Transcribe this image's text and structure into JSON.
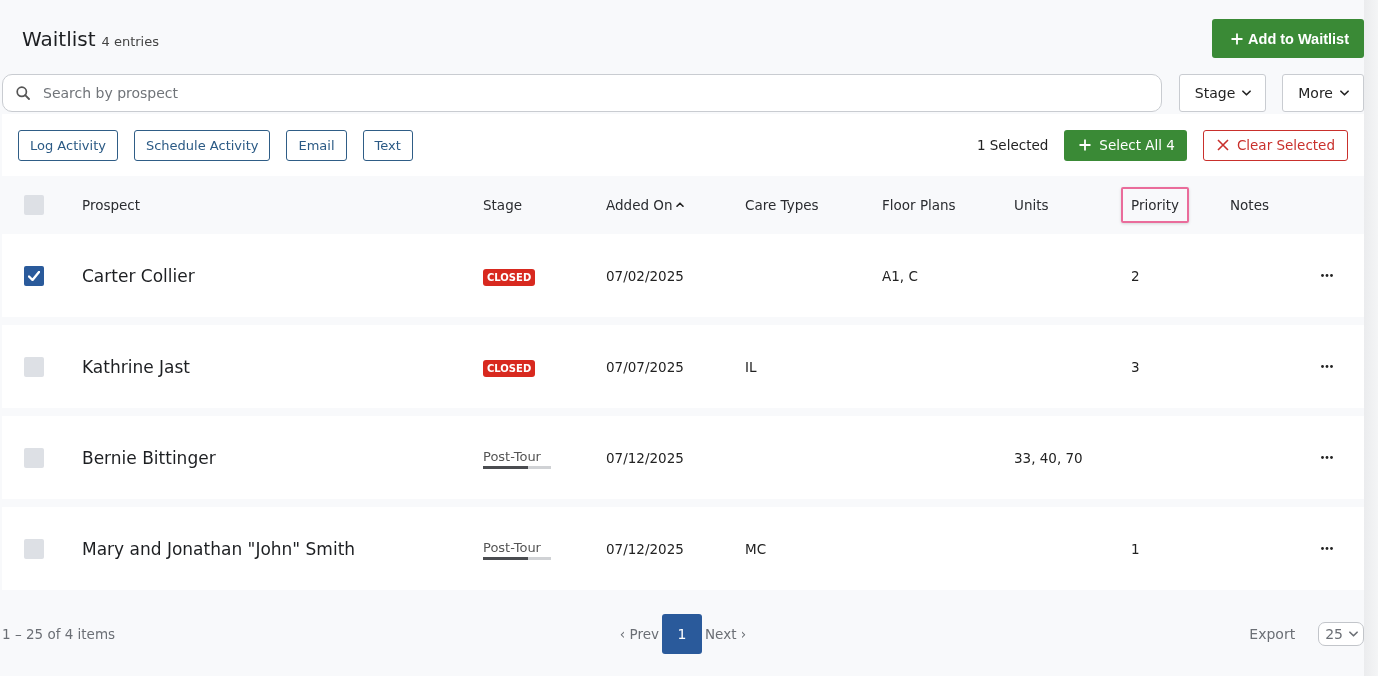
{
  "header": {
    "title": "Waitlist",
    "count": "4 entries",
    "add_button": "Add to Waitlist"
  },
  "search": {
    "placeholder": "Search by prospect"
  },
  "filters": [
    {
      "label": "Stage"
    },
    {
      "label": "More"
    }
  ],
  "actions": [
    "Log Activity",
    "Schedule Activity",
    "Email",
    "Text"
  ],
  "selection": {
    "summary": "1 Selected",
    "select_all": "Select All 4",
    "clear": "Clear Selected"
  },
  "table": {
    "all_checked": false,
    "columns": [
      {
        "label": "Prospect",
        "sorted": false,
        "highlighted": false
      },
      {
        "label": "Stage",
        "sorted": false,
        "highlighted": false
      },
      {
        "label": "Added On",
        "sorted": true,
        "highlighted": false
      },
      {
        "label": "Care Types",
        "sorted": false,
        "highlighted": false
      },
      {
        "label": "Floor Plans",
        "sorted": false,
        "highlighted": false
      },
      {
        "label": "Units",
        "sorted": false,
        "highlighted": false
      },
      {
        "label": "Priority",
        "sorted": false,
        "highlighted": true
      },
      {
        "label": "Notes",
        "sorted": false,
        "highlighted": false
      }
    ],
    "rows": [
      {
        "selected": true,
        "prospect": "Carter Collier",
        "stage": {
          "kind": "badge",
          "label": "CLOSED"
        },
        "added_on": "07/02/2025",
        "floor_plans": "A1, C",
        "priority": "2"
      },
      {
        "selected": false,
        "prospect": "Kathrine Jast",
        "stage": {
          "kind": "badge",
          "label": "CLOSED"
        },
        "added_on": "07/07/2025",
        "care_types": "IL",
        "priority": "3"
      },
      {
        "selected": false,
        "prospect": "Bernie Bittinger",
        "stage": {
          "kind": "progress",
          "label": "Post-Tour",
          "level": 0.66
        },
        "added_on": "07/12/2025",
        "units": "33, 40, 70"
      },
      {
        "selected": false,
        "prospect": "Mary and Jonathan \"John\" Smith",
        "stage": {
          "kind": "progress",
          "label": "Post-Tour",
          "level": 0.66
        },
        "added_on": "07/12/2025",
        "care_types": "MC",
        "priority": "1"
      }
    ]
  },
  "footer": {
    "range": "1 – 25 of 4 items",
    "prev": "‹ Prev",
    "pages": [
      {
        "label": "1",
        "selected": true
      }
    ],
    "next": "Next ›",
    "export": "Export",
    "page_size": "25"
  }
}
